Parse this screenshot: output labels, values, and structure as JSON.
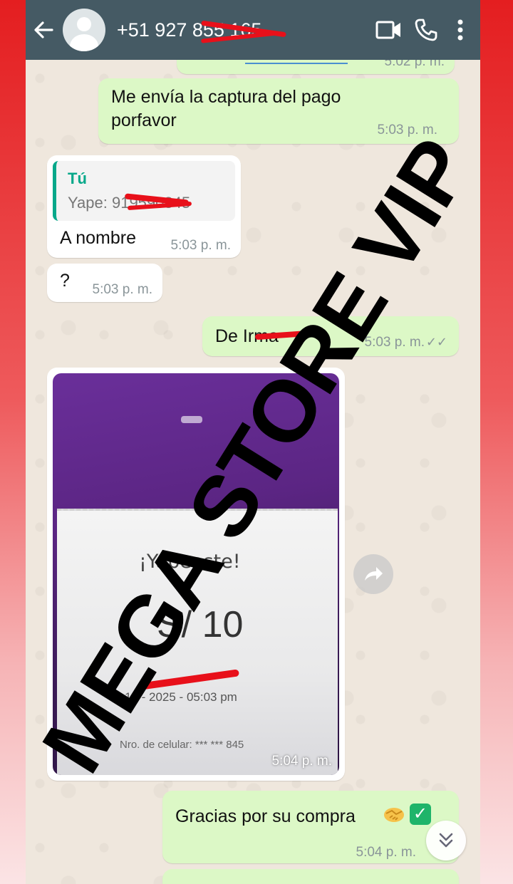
{
  "header": {
    "contact_name": "+51 927 855 165",
    "background_color": "#455a64",
    "icons": [
      "back-arrow-icon",
      "avatar",
      "video-call-icon",
      "voice-call-icon",
      "more-vert-icon"
    ]
  },
  "messages": {
    "m0_time": "5:02 p. m.",
    "m1_text_line1": "Me envía la captura del pago",
    "m1_text_line2": "porfavor",
    "m1_time": "5:03 p. m.",
    "m2_reply_author": "Tú",
    "m2_reply_text": "Yape: 919590845",
    "m2_text": "A nombre",
    "m2_time": "5:03 p. m.",
    "m3_text": "?",
    "m3_time": "5:03 p. m.",
    "m4_text": "De Irma",
    "m4_time": "5:03 p. m.",
    "m5_time": "5:04 p. m.",
    "m6_text": "Gracias por su compra",
    "m6_time": "5:04 p. m."
  },
  "receipt": {
    "title": "¡Yapeaste!",
    "amount": "S/ 10",
    "date": "15 - 2025 - 05:03 pm",
    "phone_label": "Nro. de celular: *** *** 845"
  },
  "colors": {
    "outgoing_bubble": "#dcf8c6",
    "incoming_bubble": "#ffffff",
    "reply_accent": "#06a88a",
    "chat_background": "#efe7dd"
  },
  "watermark": "MEGA STORE VIP"
}
